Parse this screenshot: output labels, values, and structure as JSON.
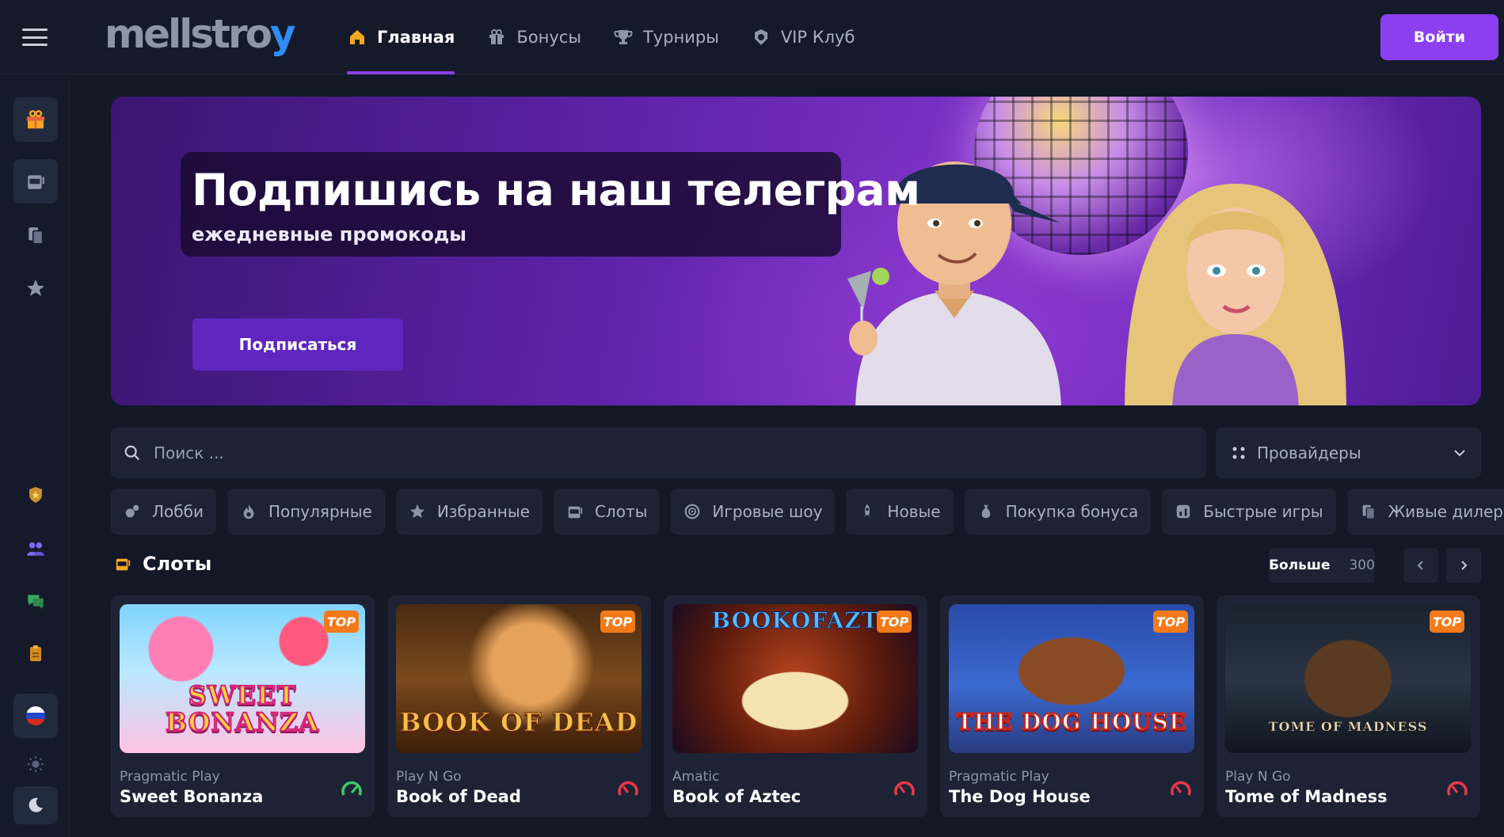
{
  "header": {
    "logo": {
      "part1": "mellstro",
      "part2": "y"
    },
    "nav": [
      {
        "label": "Главная",
        "icon": "home-icon",
        "active": true
      },
      {
        "label": "Бонусы",
        "icon": "gift-icon",
        "active": false
      },
      {
        "label": "Турниры",
        "icon": "trophy-icon",
        "active": false
      },
      {
        "label": "VIP Клуб",
        "icon": "vip-icon",
        "active": false
      }
    ],
    "login_label": "Войти"
  },
  "sidebar": {
    "top_items": [
      "gift-icon",
      "slot-machine-icon",
      "cards-icon",
      "star-icon"
    ],
    "bottom_items": [
      "shield-icon",
      "users-icon",
      "chat-icon",
      "clipboard-icon",
      "russia-flag-icon",
      "sun-icon",
      "moon-icon"
    ]
  },
  "hero": {
    "title": "Подпишись на наш телеграм",
    "subtitle": "ежедневные промокоды",
    "button_label": "Подписаться"
  },
  "search": {
    "placeholder": "Поиск ...",
    "providers_label": "Провайдеры"
  },
  "categories": [
    {
      "label": "Лобби",
      "icon": "lobby-icon"
    },
    {
      "label": "Популярные",
      "icon": "fire-icon"
    },
    {
      "label": "Избранные",
      "icon": "star-icon"
    },
    {
      "label": "Слоты",
      "icon": "slot-machine-icon"
    },
    {
      "label": "Игровые шоу",
      "icon": "wheel-icon"
    },
    {
      "label": "Новые",
      "icon": "rocket-icon"
    },
    {
      "label": "Покупка бонуса",
      "icon": "money-bag-icon"
    },
    {
      "label": "Быстрые игры",
      "icon": "quick-game-icon"
    },
    {
      "label": "Живые дилеры",
      "icon": "live-dealer-icon"
    }
  ],
  "section": {
    "title": "Слоты",
    "more_label": "Больше",
    "more_count": "300"
  },
  "games": [
    {
      "provider": "Pragmatic Play",
      "name": "Sweet Bonanza",
      "badge": "TOP",
      "thumb_text": "SWEET BONANZA",
      "volatility": "low"
    },
    {
      "provider": "Play N Go",
      "name": "Book of Dead",
      "badge": "TOP",
      "thumb_text": "BOOK OF DEAD",
      "volatility": "high"
    },
    {
      "provider": "Amatic",
      "name": "Book of Aztec",
      "badge": "TOP",
      "thumb_text": "BOOKOFAZT",
      "volatility": "high"
    },
    {
      "provider": "Pragmatic Play",
      "name": "The Dog House",
      "badge": "TOP",
      "thumb_text": "THE DOG HOUSE",
      "volatility": "high"
    },
    {
      "provider": "Play N Go",
      "name": "Tome of Madness",
      "badge": "TOP",
      "thumb_text": "TOME OF MADNESS",
      "volatility": "high"
    }
  ],
  "colors": {
    "accent": "#8b3ff0",
    "badge": "#f27a1a",
    "panel": "#1d2334",
    "background": "#131827"
  }
}
